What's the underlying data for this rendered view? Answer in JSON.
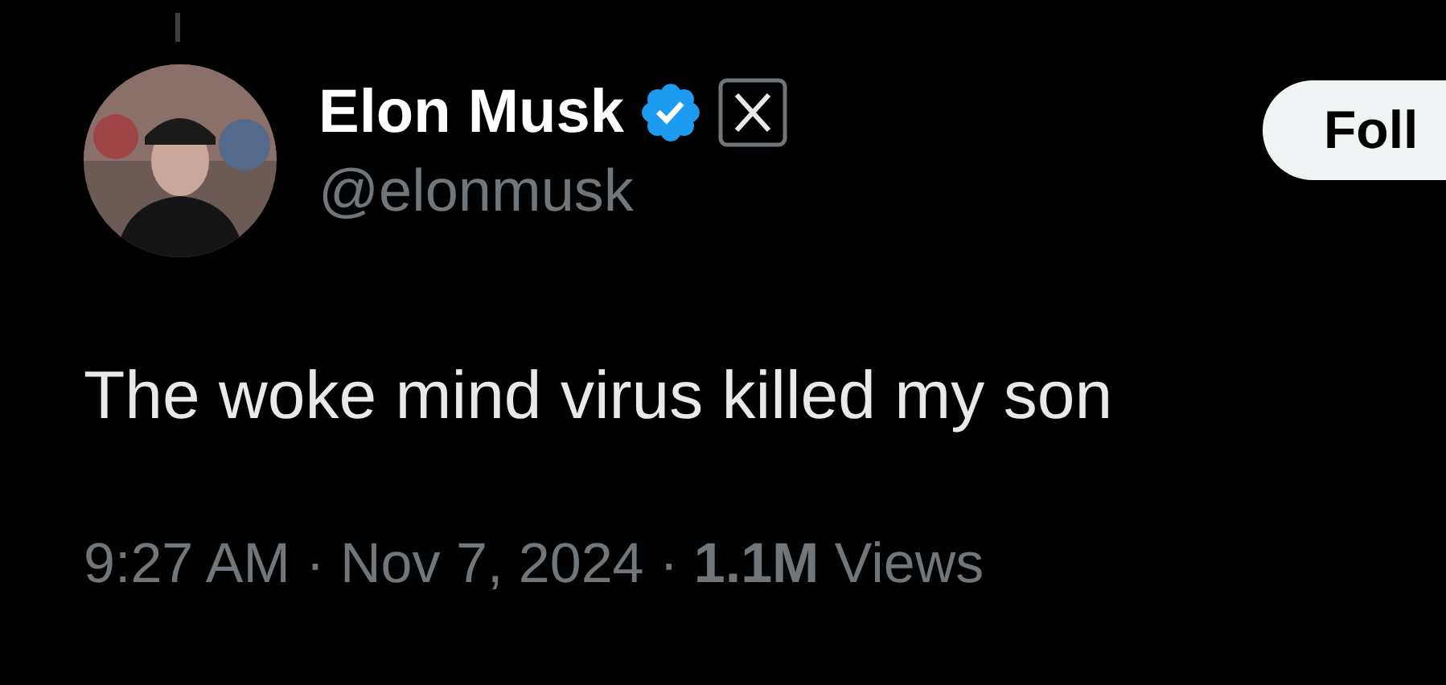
{
  "author": {
    "name": "Elon Musk",
    "verified": true,
    "handle": "@elonmusk"
  },
  "follow_button": {
    "label": "Foll"
  },
  "post": {
    "text": "The woke mind virus killed my son"
  },
  "meta": {
    "text": "9:27 AM · Nov 7, 2024 · **1.1M** Views"
  }
}
